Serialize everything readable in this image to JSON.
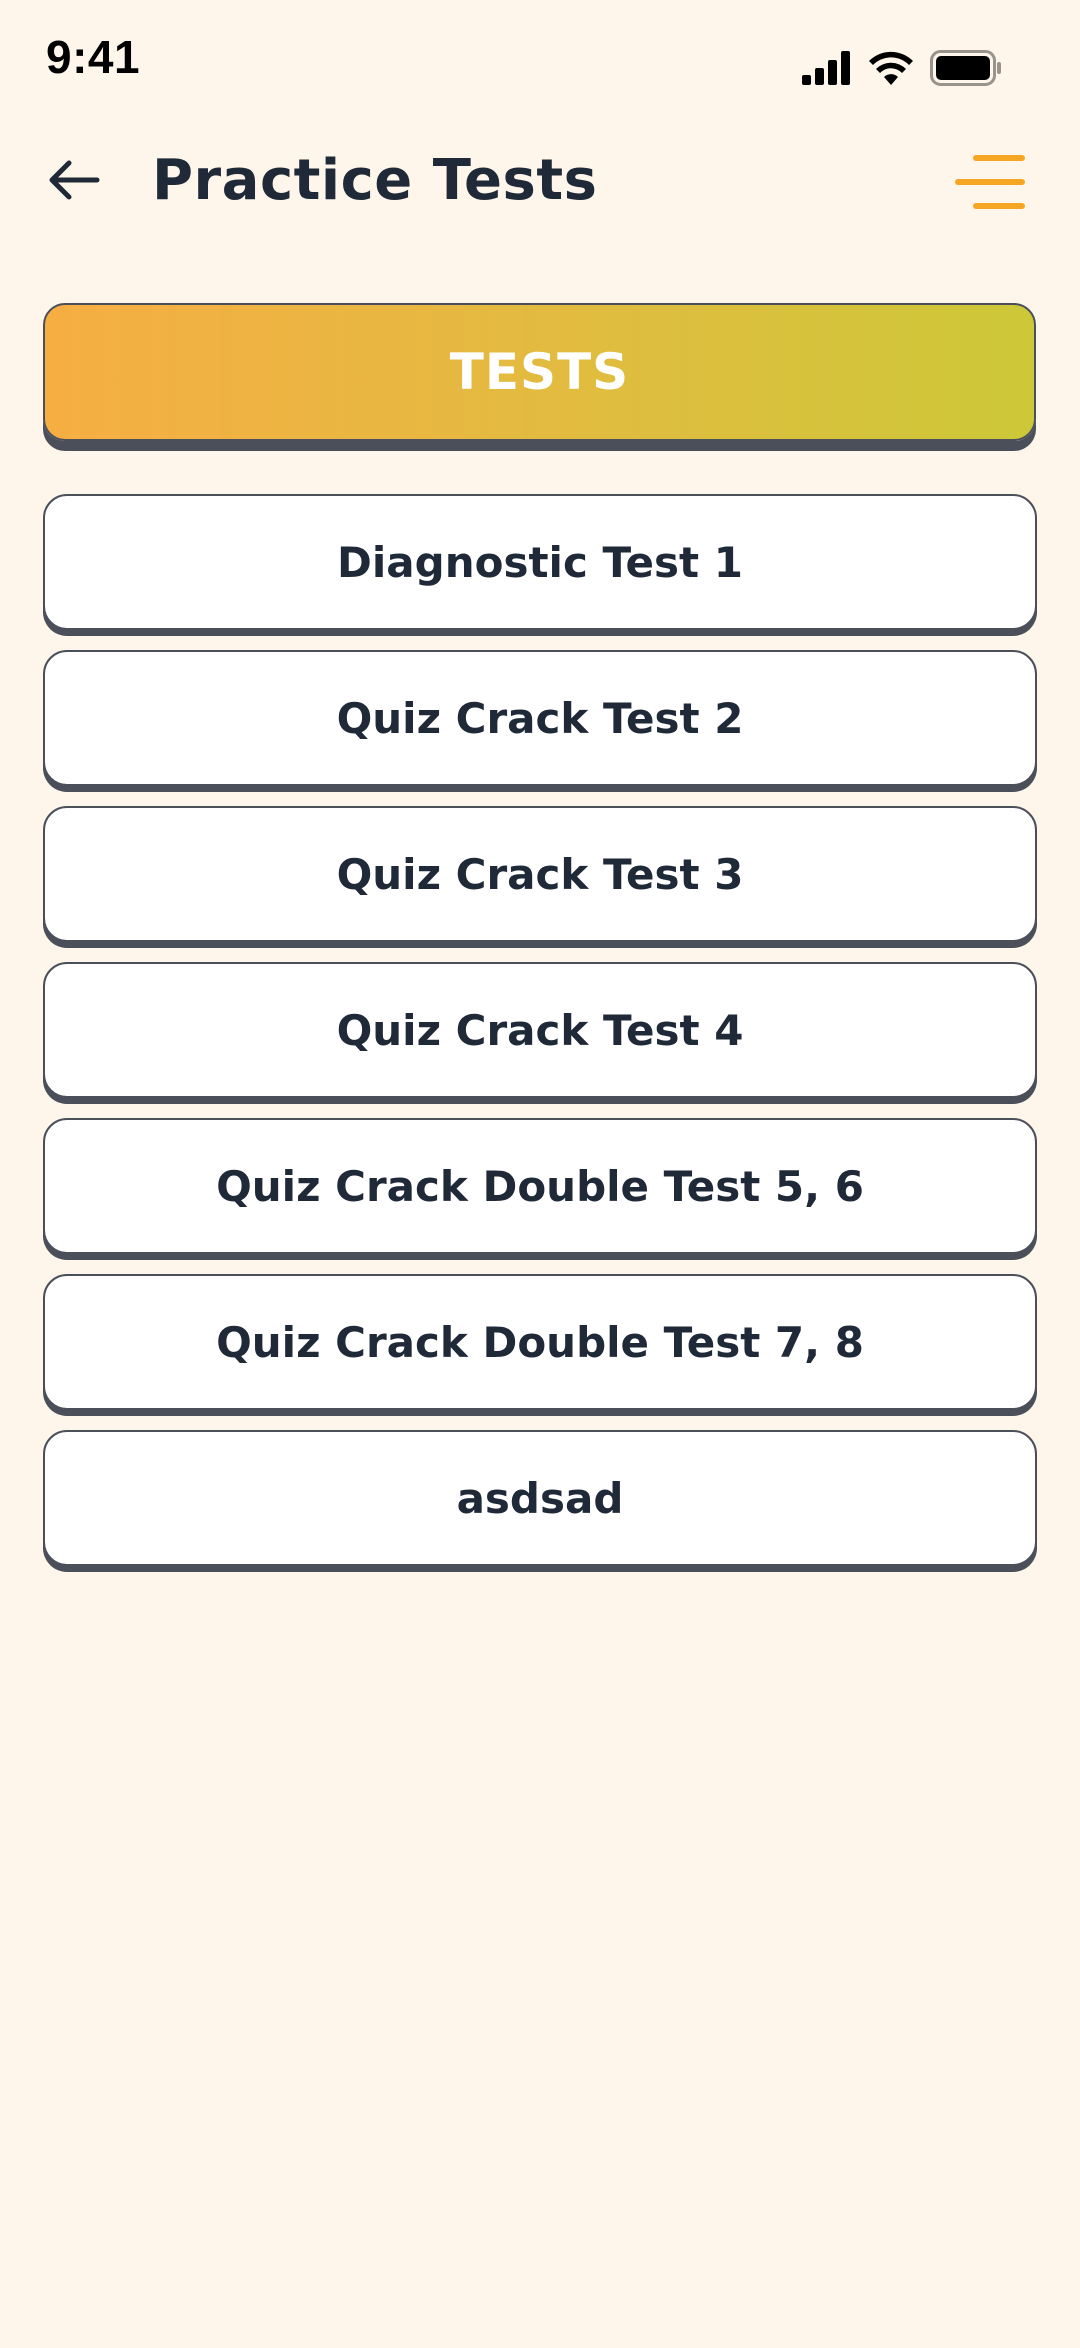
{
  "status_bar": {
    "time": "9:41"
  },
  "header": {
    "title": "Practice Tests",
    "back_icon": "arrow-left-icon",
    "menu_icon": "menu-icon",
    "menu_color": "#F5A623"
  },
  "banner": {
    "label": "TESTS",
    "gradient_start": "#F6AE43",
    "gradient_end": "#CDC839"
  },
  "tests": [
    {
      "label": "Diagnostic Test 1"
    },
    {
      "label": "Quiz Crack  Test 2"
    },
    {
      "label": "Quiz Crack  Test 3"
    },
    {
      "label": "Quiz Crack  Test 4"
    },
    {
      "label": "Quiz Crack  Double Test 5, 6"
    },
    {
      "label": "Quiz Crack  Double Test 7, 8"
    },
    {
      "label": "asdsad"
    }
  ],
  "colors": {
    "background": "#FEF6EA",
    "text": "#1F2937",
    "border": "#4A4F5A"
  }
}
